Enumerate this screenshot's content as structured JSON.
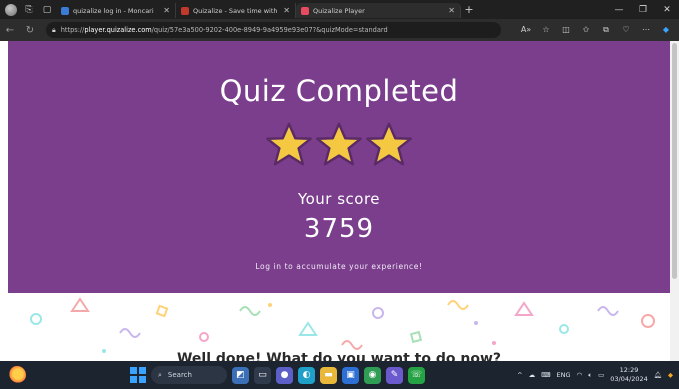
{
  "browser": {
    "tabs": [
      {
        "title": "quizalize log in - Moncari",
        "favicon_color": "#3a7bd5"
      },
      {
        "title": "Quizalize - Save time with person",
        "favicon_color": "#c0392b"
      },
      {
        "title": "Quizalize Player",
        "favicon_color": "#e84a5f"
      }
    ],
    "url_prefix": "https://",
    "url_domain": "player.quizalize.com",
    "url_path": "/quiz/57e3a500-9202-400e-8949-9a4959e93e07?&quizMode=standard"
  },
  "quiz": {
    "title": "Quiz Completed",
    "stars": 3,
    "score_label": "Your score",
    "score": "3759",
    "login_prompt": "Log in to accumulate your experience!",
    "well_done_partial": "Well done! What do you want to do now?",
    "purple": "#7b3e8d",
    "star_color": "#f5c842"
  },
  "taskbar": {
    "search_label": "Search",
    "language": "ENG",
    "time": "12:29",
    "date": "03/04/2024"
  }
}
